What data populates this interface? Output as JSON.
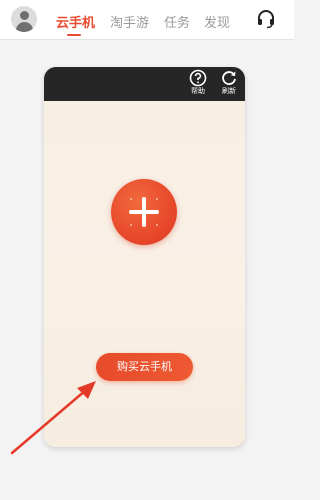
{
  "header": {
    "tabs": [
      {
        "label": "云手机",
        "active": true
      },
      {
        "label": "淘手游",
        "active": false
      },
      {
        "label": "任务",
        "active": false
      },
      {
        "label": "发现",
        "active": false
      }
    ],
    "icons": {
      "avatar": "user-avatar-icon",
      "support": "headset-icon"
    }
  },
  "phone_card": {
    "actions": [
      {
        "label": "帮助",
        "icon": "help-icon"
      },
      {
        "label": "刷新",
        "icon": "refresh-icon"
      }
    ],
    "add_icon": "plus-icon",
    "buy_button_label": "购买云手机"
  },
  "colors": {
    "accent": "#ea4a2f",
    "card_header": "#262626",
    "card_background": "#f8efe5",
    "annotation_arrow": "#e53a2a"
  }
}
